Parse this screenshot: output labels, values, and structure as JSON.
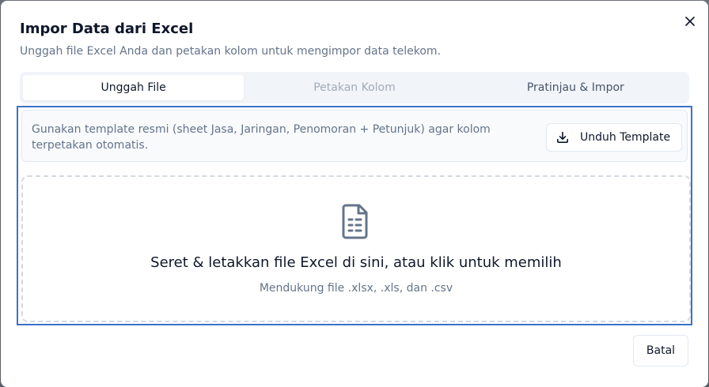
{
  "dialog": {
    "title": "Impor Data dari Excel",
    "subtitle": "Unggah file Excel Anda dan petakan kolom untuk mengimpor data telekom.",
    "close_icon": "close-icon"
  },
  "tabs": [
    {
      "label": "Unggah File",
      "state": "active"
    },
    {
      "label": "Petakan Kolom",
      "state": "disabled"
    },
    {
      "label": "Pratinjau & Impor",
      "state": "inactive"
    }
  ],
  "info": {
    "text": "Gunakan template resmi (sheet Jasa, Jaringan, Penomoran + Petunjuk) agar kolom terpetakan otomatis.",
    "download_label": "Unduh Template",
    "download_icon": "download-icon"
  },
  "dropzone": {
    "icon": "file-spreadsheet-icon",
    "title": "Seret & letakkan file Excel di sini, atau klik untuk memilih",
    "subtitle": "Mendukung file .xlsx, .xls, dan .csv"
  },
  "footer": {
    "cancel_label": "Batal"
  },
  "colors": {
    "focus_border": "#3b73c8",
    "text_primary": "#0f172a",
    "text_muted": "#64748b"
  }
}
